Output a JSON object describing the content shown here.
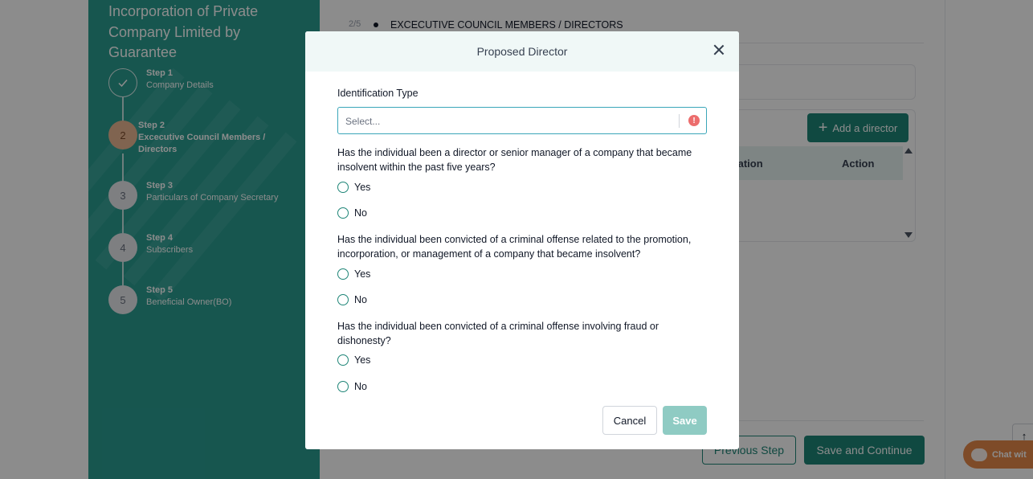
{
  "sidebar": {
    "title": "Incorporation of Private Company Limited by Guarantee",
    "steps": [
      {
        "number": "",
        "label": "Step 1",
        "name": "Company Details",
        "status": "done"
      },
      {
        "number": "2",
        "label": "Step 2",
        "name": "Excecutive Council Members / Directors",
        "status": "current"
      },
      {
        "number": "3",
        "label": "Step 3",
        "name": "Particulars of Company Secretary",
        "status": "todo"
      },
      {
        "number": "4",
        "label": "Step 4",
        "name": "Subscribers",
        "status": "todo"
      },
      {
        "number": "5",
        "label": "Step 5",
        "name": "Beneficial Owner(BO)",
        "status": "todo"
      }
    ]
  },
  "main": {
    "step_counter": "2/5",
    "section_title": "EXCECUTIVE COUNCIL MEMBERS / DIRECTORS",
    "add_director_label": "Add a director",
    "table_headers": {
      "information": "rmation",
      "action": "Action"
    },
    "previous_step_label": "Previous Step",
    "save_continue_label": "Save and Continue",
    "chat_label": "Chat wit"
  },
  "modal": {
    "title": "Proposed Director",
    "identification_type_label": "Identification Type",
    "identification_placeholder": "Select...",
    "questions": [
      {
        "text": "Has the individual been a director or senior manager of a company that became insolvent within the past five years?",
        "options": [
          "Yes",
          "No"
        ]
      },
      {
        "text": "Has the individual been convicted of a criminal offense related to the promotion, incorporation, or management of a company that became insolvent?",
        "options": [
          "Yes",
          "No"
        ]
      },
      {
        "text": "Has the individual been convicted of a criminal offense involving fraud or dishonesty?",
        "options": [
          "Yes",
          "No"
        ]
      }
    ],
    "cancel_label": "Cancel",
    "save_label": "Save"
  },
  "colors": {
    "sidebar": "#2a9d91",
    "primary": "#1e8577",
    "save_disabled": "#8fcbc3",
    "error": "#ec6d6d"
  }
}
